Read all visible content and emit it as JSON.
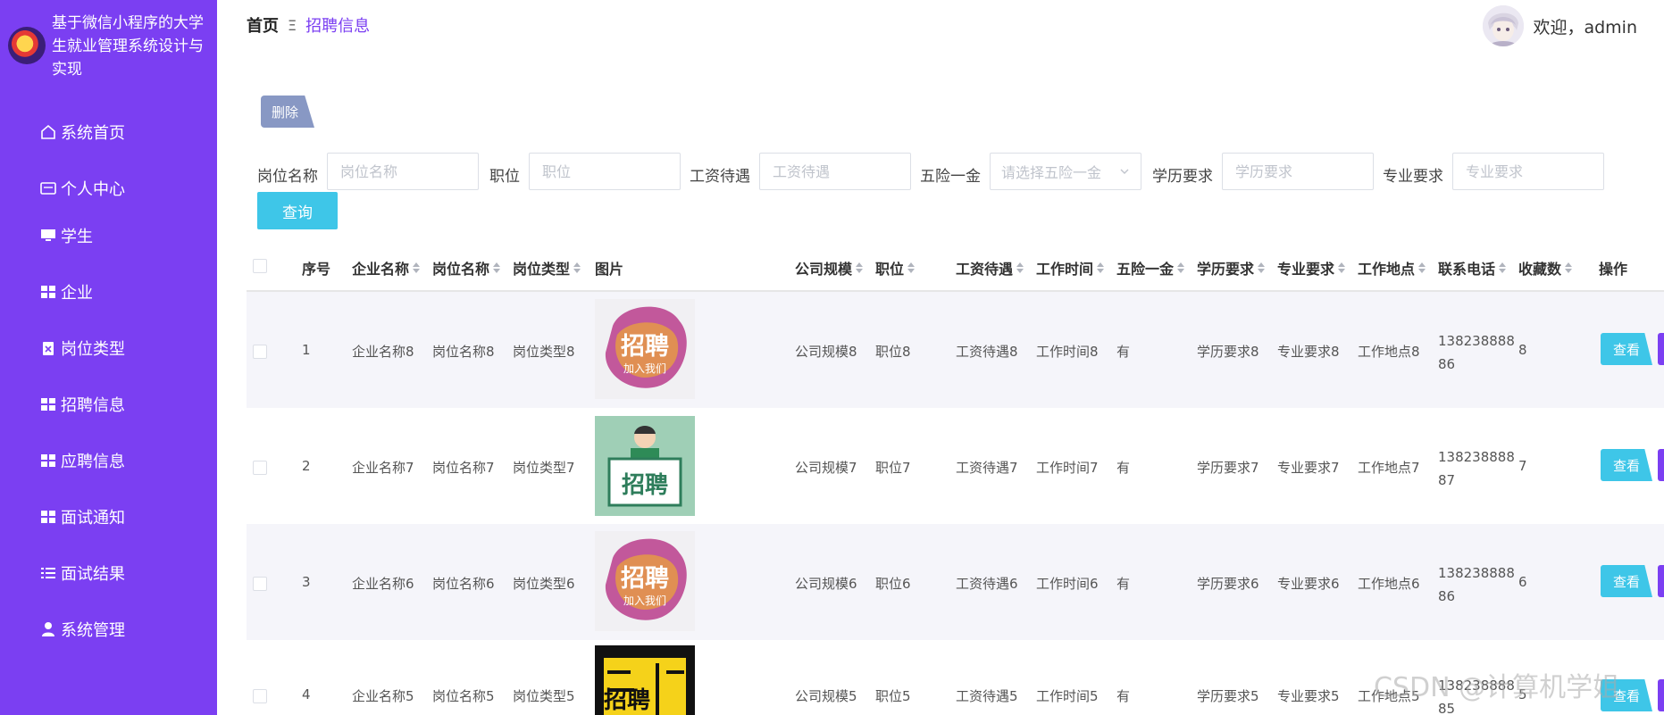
{
  "app": {
    "title": "基于微信小程序的大学生就业管理系统设计与实现"
  },
  "sidebar": {
    "items": [
      {
        "label": "系统首页",
        "icon": "home-icon"
      },
      {
        "label": "个人中心",
        "icon": "id-card-icon"
      },
      {
        "label": "学生",
        "icon": "monitor-icon"
      },
      {
        "label": "企业",
        "icon": "grid-icon"
      },
      {
        "label": "岗位类型",
        "icon": "clipboard-icon"
      },
      {
        "label": "招聘信息",
        "icon": "grid-icon"
      },
      {
        "label": "应聘信息",
        "icon": "grid-icon"
      },
      {
        "label": "面试通知",
        "icon": "grid-icon"
      },
      {
        "label": "面试结果",
        "icon": "list-icon"
      },
      {
        "label": "系统管理",
        "icon": "user-icon"
      }
    ]
  },
  "breadcrumb": {
    "home": "首页",
    "separator": "Ξ",
    "current": "招聘信息"
  },
  "user": {
    "welcome": "欢迎，admin"
  },
  "toolbar": {
    "delete_label": "删除",
    "query_label": "查询"
  },
  "search": {
    "job_name": {
      "label": "岗位名称",
      "placeholder": "岗位名称"
    },
    "position": {
      "label": "职位",
      "placeholder": "职位"
    },
    "salary": {
      "label": "工资待遇",
      "placeholder": "工资待遇"
    },
    "insurance": {
      "label": "五险一金",
      "placeholder": "请选择五险一金"
    },
    "education": {
      "label": "学历要求",
      "placeholder": "学历要求"
    },
    "major": {
      "label": "专业要求",
      "placeholder": "专业要求"
    }
  },
  "table": {
    "headers": {
      "index": "序号",
      "company": "企业名称",
      "job_name": "岗位名称",
      "job_type": "岗位类型",
      "image": "图片",
      "scale": "公司规模",
      "position": "职位",
      "salary": "工资待遇",
      "work_time": "工作时间",
      "insurance": "五险一金",
      "education": "学历要求",
      "major": "专业要求",
      "location": "工作地点",
      "phone": "联系电话",
      "favorites": "收藏数",
      "action": "操作"
    },
    "view_label": "查看",
    "rows": [
      {
        "index": "1",
        "company": "企业名称8",
        "job_name": "岗位名称8",
        "job_type": "岗位类型8",
        "image_text": "招聘",
        "image_sub": "加入我们",
        "scale": "公司规模8",
        "position": "职位8",
        "salary": "工资待遇8",
        "work_time": "工作时间8",
        "insurance": "有",
        "education": "学历要求8",
        "major": "专业要求8",
        "location": "工作地点8",
        "phone": "13823888886",
        "favorites": "8"
      },
      {
        "index": "2",
        "company": "企业名称7",
        "job_name": "岗位名称7",
        "job_type": "岗位类型7",
        "image_text": "招聘",
        "image_sub": "",
        "scale": "公司规模7",
        "position": "职位7",
        "salary": "工资待遇7",
        "work_time": "工作时间7",
        "insurance": "有",
        "education": "学历要求7",
        "major": "专业要求7",
        "location": "工作地点7",
        "phone": "13823888887",
        "favorites": "7"
      },
      {
        "index": "3",
        "company": "企业名称6",
        "job_name": "岗位名称6",
        "job_type": "岗位类型6",
        "image_text": "招聘",
        "image_sub": "加入我们",
        "scale": "公司规模6",
        "position": "职位6",
        "salary": "工资待遇6",
        "work_time": "工作时间6",
        "insurance": "有",
        "education": "学历要求6",
        "major": "专业要求6",
        "location": "工作地点6",
        "phone": "13823888886",
        "favorites": "6"
      },
      {
        "index": "4",
        "company": "企业名称5",
        "job_name": "岗位名称5",
        "job_type": "岗位类型5",
        "image_text": "招聘",
        "image_sub": "",
        "scale": "公司规模5",
        "position": "职位5",
        "salary": "工资待遇5",
        "work_time": "工作时间5",
        "insurance": "有",
        "education": "学历要求5",
        "major": "专业要求5",
        "location": "工作地点5",
        "phone": "13823888885",
        "favorites": "5"
      }
    ]
  },
  "watermark": "CSDN @计算机学姐",
  "colors": {
    "sidebar": "#7b3ff2",
    "accent": "#7b3ff2",
    "button_cyan": "#3ec6e8",
    "delete_button": "#8898c4"
  }
}
